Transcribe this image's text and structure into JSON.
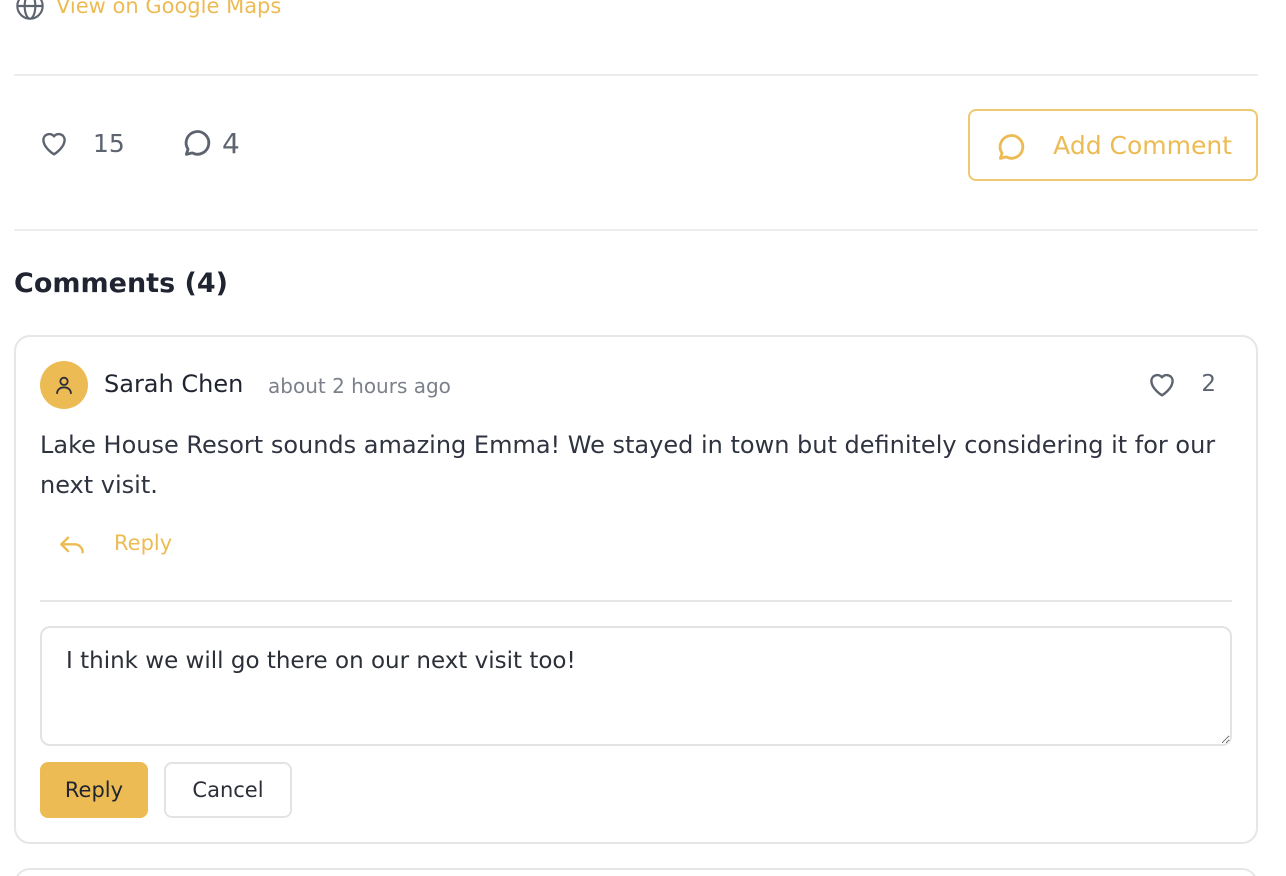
{
  "location": {
    "maps_link": "View on Google Maps",
    "maps_icon": "globe-icon"
  },
  "stats": {
    "likes_count": "15",
    "comments_count": "4",
    "like_icon": "heart-icon",
    "comment_icon": "speech-bubble-icon"
  },
  "actions": {
    "add_comment_label": "Add Comment"
  },
  "comments_section": {
    "title": "Comments (4)",
    "items": [
      {
        "author": "Sarah Chen",
        "timestamp": "about 2 hours ago",
        "likes": "2",
        "body": "Lake House Resort sounds amazing Emma! We stayed in town but definitely considering it for our next visit.",
        "reply_label": "Reply",
        "avatar_icon": "user-icon"
      }
    ],
    "reply_form": {
      "value": "I think we will go there on our next visit too!",
      "submit_label": "Reply",
      "cancel_label": "Cancel"
    }
  },
  "colors": {
    "accent": "#ecbb54",
    "border": "#e6e6e6",
    "text": "#2b2f38"
  }
}
